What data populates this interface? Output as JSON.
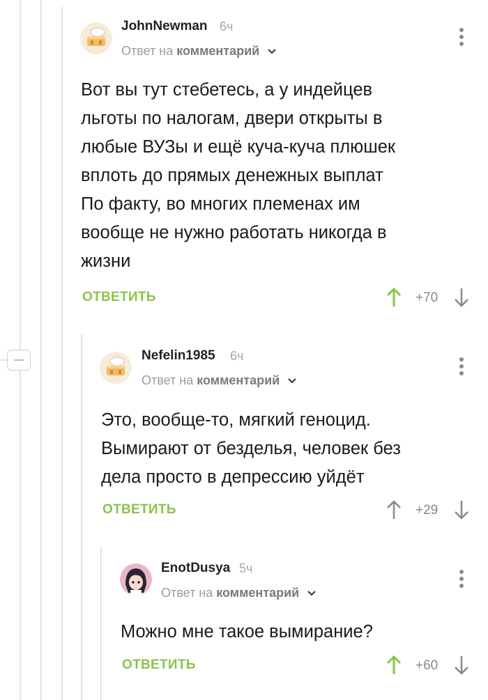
{
  "colors": {
    "accent": "#8bc34a",
    "muted": "#9c9c9c",
    "thread_line": "#e3e3e3"
  },
  "comments": [
    {
      "author": "JohnNewman",
      "time": "6ч",
      "reply_prefix": "Ответ на",
      "reply_target": "комментарий",
      "lines": [
        "Вот вы тут стебетесь, а у индейцев",
        "льготы по налогам, двери открыты в",
        "любые ВУЗы и ещё куча-куча плюшек",
        "вплоть до прямых денежных выплат",
        "По факту, во многих племенах им",
        "вообще не нужно работать никогда в",
        "жизни"
      ],
      "reply_label": "ОТВЕТИТЬ",
      "rating": "+70",
      "upvoted": true,
      "avatar_icon": "cake-avatar-icon"
    },
    {
      "author": "Nefelin1985",
      "time": "6ч",
      "reply_prefix": "Ответ на",
      "reply_target": "комментарий",
      "lines": [
        "Это, вообще-то, мягкий геноцид.",
        "Вымирают от безделья, человек без",
        "дела просто в депрессию уйдёт"
      ],
      "reply_label": "ОТВЕТИТЬ",
      "rating": "+29",
      "upvoted": false,
      "avatar_icon": "cake-avatar-icon"
    },
    {
      "author": "EnotDusya",
      "time": "5ч",
      "reply_prefix": "Ответ на",
      "reply_target": "комментарий",
      "lines": [
        "Можно мне такое вымирание?"
      ],
      "reply_label": "ОТВЕТИТЬ",
      "rating": "+60",
      "upvoted": true,
      "avatar_icon": "anime-girl-avatar-icon"
    }
  ]
}
